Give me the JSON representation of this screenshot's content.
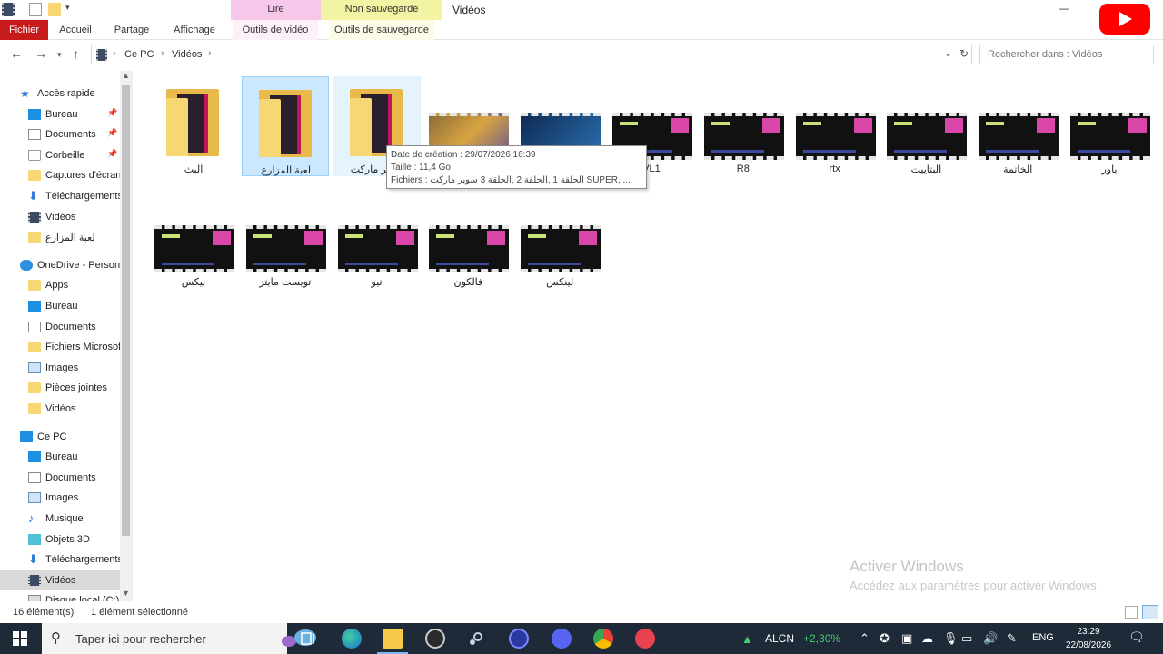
{
  "window": {
    "title": "Vidéos",
    "context_tabs": {
      "lire": "Lire",
      "non_sauvegarde": "Non sauvegardé"
    },
    "ribbon_tabs": [
      "Fichier",
      "Accueil",
      "Partage",
      "Affichage",
      "Outils de vidéo",
      "Outils de sauvegarde"
    ],
    "minimize": "—"
  },
  "address": {
    "crumbs": [
      "Ce PC",
      "Vidéos"
    ],
    "search_placeholder": "Rechercher dans : Vidéos"
  },
  "sidebar": {
    "items": [
      {
        "label": "Accès rapide",
        "icon": "star-icon",
        "level": 0
      },
      {
        "label": "Bureau",
        "icon": "desktop-icon",
        "level": 1,
        "pinned": true
      },
      {
        "label": "Documents",
        "icon": "document-icon",
        "level": 1,
        "pinned": true
      },
      {
        "label": "Corbeille",
        "icon": "recycle-bin-icon",
        "level": 1,
        "pinned": true
      },
      {
        "label": "Captures d'écran",
        "icon": "folder-icon",
        "level": 1
      },
      {
        "label": "Téléchargements",
        "icon": "download-icon",
        "level": 1
      },
      {
        "label": "Vidéos",
        "icon": "video-icon",
        "level": 1
      },
      {
        "label": "لعبة المزارع",
        "icon": "folder-icon",
        "level": 1
      },
      {
        "label": "OneDrive - Personal",
        "icon": "cloud-icon",
        "level": 0
      },
      {
        "label": "Apps",
        "icon": "folder-icon",
        "level": 1
      },
      {
        "label": "Bureau",
        "icon": "desktop-icon",
        "level": 1
      },
      {
        "label": "Documents",
        "icon": "document-icon",
        "level": 1
      },
      {
        "label": "Fichiers Microsoft",
        "icon": "folder-icon",
        "level": 1
      },
      {
        "label": "Images",
        "icon": "image-icon",
        "level": 1
      },
      {
        "label": "Pièces jointes",
        "icon": "folder-icon",
        "level": 1
      },
      {
        "label": "Vidéos",
        "icon": "folder-icon",
        "level": 1
      },
      {
        "label": "Ce PC",
        "icon": "computer-icon",
        "level": 0
      },
      {
        "label": "Bureau",
        "icon": "desktop-icon",
        "level": 1
      },
      {
        "label": "Documents",
        "icon": "document-icon",
        "level": 1
      },
      {
        "label": "Images",
        "icon": "image-icon",
        "level": 1
      },
      {
        "label": "Musique",
        "icon": "music-icon",
        "level": 1
      },
      {
        "label": "Objets 3D",
        "icon": "cube-icon",
        "level": 1
      },
      {
        "label": "Téléchargements",
        "icon": "download-icon",
        "level": 1
      },
      {
        "label": "Vidéos",
        "icon": "video-icon",
        "level": 1,
        "selected": true
      },
      {
        "label": "Disque local (C:)",
        "icon": "drive-icon",
        "level": 1
      }
    ]
  },
  "content": {
    "items": [
      {
        "label": "البث",
        "kind": "folder"
      },
      {
        "label": "لعبة المزارع",
        "kind": "folder",
        "selected": true
      },
      {
        "label": "سوبر ماركت",
        "kind": "folder",
        "hovered": true
      },
      {
        "label": "",
        "kind": "video",
        "thumb": "game"
      },
      {
        "label": "",
        "kind": "video",
        "thumb": "blue"
      },
      {
        "label": "VL1",
        "kind": "video"
      },
      {
        "label": "R8",
        "kind": "video"
      },
      {
        "label": "rtx",
        "kind": "video"
      },
      {
        "label": "البتاييت",
        "kind": "video"
      },
      {
        "label": "الخاتمة",
        "kind": "video"
      },
      {
        "label": "باور",
        "kind": "video"
      },
      {
        "label": "بيكس",
        "kind": "video"
      },
      {
        "label": "تويست مايتز",
        "kind": "video"
      },
      {
        "label": "تيو",
        "kind": "video"
      },
      {
        "label": "فالكون",
        "kind": "video"
      },
      {
        "label": "لينكس",
        "kind": "video"
      }
    ]
  },
  "tooltip": {
    "line1": "Date de création : 29/07/2026 16:39",
    "line2": "Taille : 11,4 Go",
    "line3": "Fichiers : الحلقة 1 ,الحلقة 2 ,الحلقة 3 سوبر ماركت SUPER, ..."
  },
  "watermark": {
    "title": "Activer Windows",
    "subtitle": "Accédez aux paramètres pour activer Windows."
  },
  "status": {
    "count": "16 élément(s)",
    "selection": "1 élément sélectionné"
  },
  "taskbar": {
    "search_text": "Taper ici pour rechercher",
    "stock_ticker": "ALCN",
    "stock_change": "+2,30%",
    "language": "ENG",
    "time": "23:29",
    "date": "22/08/2026"
  },
  "colors": {
    "fichier_tab": "#c71a1a",
    "lire_tab": "#f7c7ea",
    "save_tab": "#f3f3a4",
    "selection": "#cce8ff"
  }
}
